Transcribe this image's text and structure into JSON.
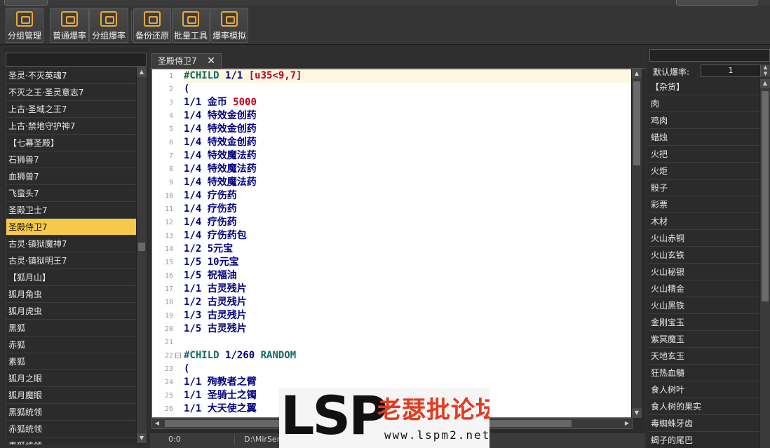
{
  "toolbar": {
    "buttons": [
      {
        "label": "分组管理",
        "icon": "group-manage-icon"
      },
      {
        "label": "普通爆率",
        "icon": "normal-rate-icon"
      },
      {
        "label": "分组爆率",
        "icon": "group-rate-icon"
      },
      {
        "label": "备份还原",
        "icon": "backup-restore-icon"
      },
      {
        "label": "批量工具",
        "icon": "batch-tool-icon"
      },
      {
        "label": "爆率模拟",
        "icon": "rate-simulate-icon"
      }
    ]
  },
  "left_list": {
    "search_value": "",
    "items": [
      {
        "label": "圣灵·不灭英魂7",
        "selected": false
      },
      {
        "label": "不灭之王·圣灵意志7",
        "selected": false
      },
      {
        "label": "上古·圣域之王7",
        "selected": false
      },
      {
        "label": "上古·禁地守护神7",
        "selected": false
      },
      {
        "label": "【七幕圣殿】",
        "selected": false
      },
      {
        "label": "石狮兽7",
        "selected": false
      },
      {
        "label": "血狮兽7",
        "selected": false
      },
      {
        "label": "飞蛮头7",
        "selected": false
      },
      {
        "label": "圣殿卫士7",
        "selected": false
      },
      {
        "label": "圣殿侍卫7",
        "selected": true
      },
      {
        "label": "古灵·镇狱魔神7",
        "selected": false
      },
      {
        "label": "古灵·镇狱明王7",
        "selected": false
      },
      {
        "label": "【狐月山】",
        "selected": false
      },
      {
        "label": "狐月角虫",
        "selected": false
      },
      {
        "label": "狐月虎虫",
        "selected": false
      },
      {
        "label": "黑狐",
        "selected": false
      },
      {
        "label": "赤狐",
        "selected": false
      },
      {
        "label": "素狐",
        "selected": false
      },
      {
        "label": "狐月之眼",
        "selected": false
      },
      {
        "label": "狐月魔眼",
        "selected": false
      },
      {
        "label": "黑狐统领",
        "selected": false
      },
      {
        "label": "赤狐统领",
        "selected": false
      },
      {
        "label": "素狐统领",
        "selected": false
      }
    ]
  },
  "editor": {
    "tab_label": "圣殿侍卫7",
    "tab_close": "✕",
    "lines": [
      {
        "n": "1",
        "text": "#CHILD 1/1 [u35<9,7]"
      },
      {
        "n": "2",
        "text": "("
      },
      {
        "n": "3",
        "text": "1/1 金币 5000"
      },
      {
        "n": "4",
        "text": "1/4 特效金创药"
      },
      {
        "n": "5",
        "text": "1/4 特效金创药"
      },
      {
        "n": "6",
        "text": "1/4 特效金创药"
      },
      {
        "n": "7",
        "text": "1/4 特效魔法药"
      },
      {
        "n": "8",
        "text": "1/4 特效魔法药"
      },
      {
        "n": "9",
        "text": "1/4 特效魔法药"
      },
      {
        "n": "10",
        "text": "1/4 疗伤药"
      },
      {
        "n": "11",
        "text": "1/4 疗伤药"
      },
      {
        "n": "12",
        "text": "1/4 疗伤药"
      },
      {
        "n": "13",
        "text": "1/4 疗伤药包"
      },
      {
        "n": "14",
        "text": "1/2 5元宝"
      },
      {
        "n": "15",
        "text": "1/5 10元宝"
      },
      {
        "n": "16",
        "text": "1/5 祝福油"
      },
      {
        "n": "17",
        "text": "1/1 古灵残片"
      },
      {
        "n": "18",
        "text": "1/2 古灵残片"
      },
      {
        "n": "19",
        "text": "1/3 古灵残片"
      },
      {
        "n": "20",
        "text": "1/5 古灵残片"
      },
      {
        "n": "21",
        "text": ""
      },
      {
        "n": "22",
        "text": "#CHILD 1/260 RANDOM"
      },
      {
        "n": "23",
        "text": "("
      },
      {
        "n": "24",
        "text": "1/1 殉教者之臂"
      },
      {
        "n": "25",
        "text": "1/1 圣骑士之镯"
      },
      {
        "n": "26",
        "text": "1/1 大天使之翼"
      }
    ]
  },
  "status": {
    "position": "0:0",
    "path": "D:\\MirServ"
  },
  "watermark": {
    "big": "LSP",
    "cn": "老瑟批论坛",
    "url": "www.lspm2.net"
  },
  "right_panel": {
    "search_value": "",
    "rate_label": "默认爆率:",
    "rate_value": "1",
    "items": [
      "【杂货】",
      "肉",
      "鸡肉",
      "蜡烛",
      "火把",
      "火炬",
      "骰子",
      "彩票",
      "木材",
      "火山赤铜",
      "火山玄铁",
      "火山秘银",
      "火山精金",
      "火山黑铁",
      "金刚宝玉",
      "紫冥魔玉",
      "天地玄玉",
      "狂热血髓",
      "食人树叶",
      "食人树的果实",
      "毒蜘蛛牙齿",
      "蝎子的尾巴"
    ]
  },
  "colors": {
    "selection": "#f7c94a",
    "toolbar_icon": "#e9a93b",
    "code_text": "#000080",
    "code_number": "#c0001e",
    "code_keyword": "#116969"
  }
}
